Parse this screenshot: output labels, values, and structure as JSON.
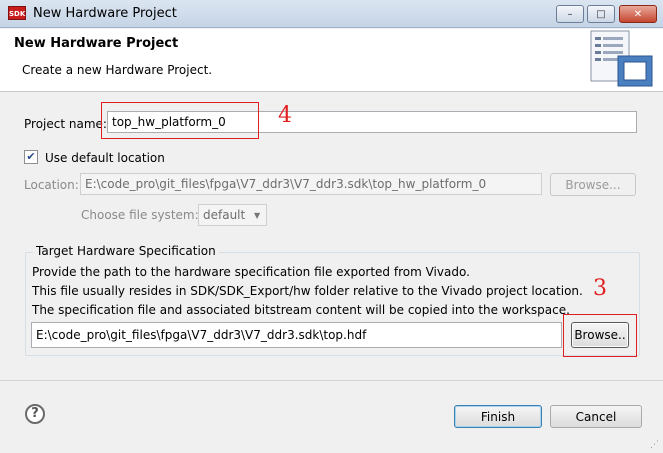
{
  "window": {
    "title": "New Hardware Project",
    "app_icon_text": "SDK",
    "minimize": "–",
    "maximize": "□",
    "close": "✕"
  },
  "header": {
    "title": "New Hardware Project",
    "description": "Create a new Hardware Project."
  },
  "form": {
    "project_name_label": "Project name:",
    "project_name_value": "top_hw_platform_0",
    "use_default_location_label": "Use default location",
    "use_default_location_checked": true,
    "location_label": "Location:",
    "location_value": "E:\\code_pro\\git_files\\fpga\\V7_ddr3\\V7_ddr3.sdk\\top_hw_platform_0",
    "location_browse_label": "Browse...",
    "file_system_label": "Choose file system:",
    "file_system_value": "default"
  },
  "target_group": {
    "title": "Target Hardware Specification",
    "desc_line1": "Provide the path to the hardware specification file exported from Vivado.",
    "desc_line2": "This file usually resides in SDK/SDK_Export/hw folder relative to the Vivado project location.",
    "desc_line3": "The specification file and associated bitstream content will be copied into the workspace.",
    "hdf_path": "E:\\code_pro\\git_files\\fpga\\V7_ddr3\\V7_ddr3.sdk\\top.hdf",
    "browse_label": "Browse.."
  },
  "annotations": {
    "label_4": "4",
    "label_3": "3",
    "color": "#e02020"
  },
  "footer": {
    "help_glyph": "?",
    "finish_label": "Finish",
    "cancel_label": "Cancel"
  }
}
